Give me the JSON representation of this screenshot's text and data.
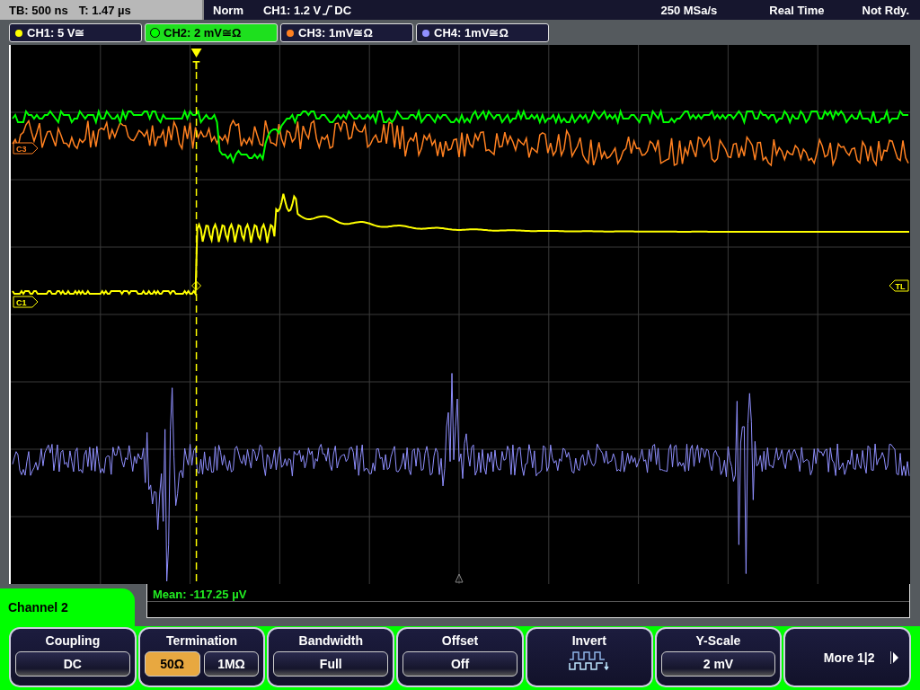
{
  "status": {
    "timebase": "TB: 500 ns",
    "trigger_time": "T: 1.47 µs",
    "mode": "Norm",
    "trigger_source": "CH1: 1.2 V",
    "trigger_coupling": "DC",
    "sample_rate": "250 MSa/s",
    "acquisition": "Real Time",
    "state": "Not Rdy."
  },
  "channel_tabs": [
    {
      "label": "CH1: 5 V≅",
      "color": "#ffff00",
      "selected": false
    },
    {
      "label": "CH2: 2 mV≅Ω",
      "color": "#00ff00",
      "selected": true
    },
    {
      "label": "CH3: 1mV≅Ω",
      "color": "#ff8020",
      "selected": false
    },
    {
      "label": "CH4: 1mV≅Ω",
      "color": "#9090ff",
      "selected": false
    }
  ],
  "markers": {
    "trigger": "T",
    "trigger_level": "TL",
    "ch1": "C1",
    "ch3": "C3"
  },
  "measurement": {
    "mean": "Mean: -117.25 µV"
  },
  "menu": {
    "title": "Channel 2"
  },
  "softkeys": [
    {
      "kind": "value",
      "label": "Coupling",
      "options": [
        {
          "text": "DC"
        }
      ]
    },
    {
      "kind": "toggle",
      "label": "Termination",
      "options": [
        {
          "text": "50Ω",
          "selected": true
        },
        {
          "text": "1MΩ",
          "selected": false
        }
      ]
    },
    {
      "kind": "value",
      "label": "Bandwidth",
      "options": [
        {
          "text": "Full"
        }
      ]
    },
    {
      "kind": "value",
      "label": "Offset",
      "options": [
        {
          "text": "Off"
        }
      ]
    },
    {
      "kind": "icon",
      "label": "Invert"
    },
    {
      "kind": "value",
      "label": "Y-Scale",
      "options": [
        {
          "text": "2 mV"
        }
      ]
    },
    {
      "kind": "more",
      "label": "More 1|2"
    }
  ]
}
